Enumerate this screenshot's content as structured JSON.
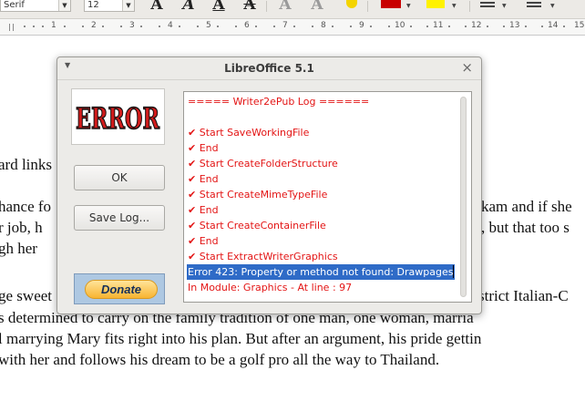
{
  "toolbar": {
    "font_name": "Serif",
    "font_size": "12",
    "icons": [
      "font-color-a-icon",
      "bold-icon",
      "italic-icon",
      "underline-icon",
      "strikethrough-icon",
      "shadow-icon",
      "highlight-icon",
      "font-color-icon",
      "char-highlight-icon",
      "list-icon",
      "numbered-list-icon"
    ]
  },
  "ruler": {
    "numbers": [
      "1",
      "2",
      "3",
      "4",
      "5",
      "6",
      "7",
      "8",
      "9",
      "10",
      "11",
      "12",
      "13",
      "14",
      "15"
    ]
  },
  "document": {
    "lines": [
      "ard links",
      "hance fo",
      "kam and if she",
      "r job, h",
      ", but that too s",
      "gh her",
      "ge sweet",
      "strict Italian-C",
      "s determined to carry on the family tradition of  one man, one woman, marria",
      "l marrying Mary fits right into his plan. But after an argument, his pride gettin",
      "with her and follows his dream to be a golf pro all the way to Thailand."
    ]
  },
  "dialog": {
    "title": "LibreOffice 5.1",
    "logo_text": "ERROR",
    "ok_label": "OK",
    "save_log_label": "Save Log...",
    "donate_label": "Donate",
    "log_lines": [
      "===== Writer2ePub Log ======",
      "",
      "✔ Start SaveWorkingFile",
      "✔ End",
      "✔ Start CreateFolderStructure",
      "✔ End",
      "✔ Start CreateMimeTypeFile",
      "✔ End",
      "✔ Start CreateContainerFile",
      "✔ End",
      "✔ Start ExtractWriterGraphics",
      "Error 423: Property or method not found: Drawpages",
      "In Module: Graphics - At line : 97"
    ]
  },
  "colors": {
    "log_text": "#e31515",
    "selection": "#2f6bc7",
    "error_logo_red": "#d11b1b",
    "donate_gold": "#f8b432"
  }
}
